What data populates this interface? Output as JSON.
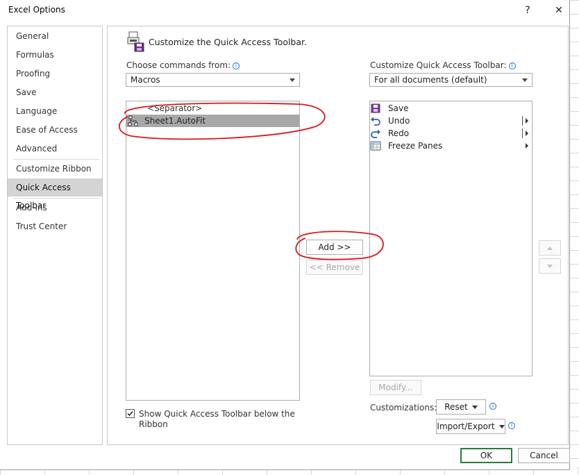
{
  "window": {
    "title": "Excel Options",
    "help_label": "?",
    "close_label": "✕"
  },
  "nav": {
    "items": [
      {
        "label": "General"
      },
      {
        "label": "Formulas"
      },
      {
        "label": "Proofing"
      },
      {
        "label": "Save"
      },
      {
        "label": "Language"
      },
      {
        "label": "Ease of Access"
      },
      {
        "label": "Advanced"
      },
      {
        "label": "Customize Ribbon"
      },
      {
        "label": "Quick Access Toolbar",
        "selected": true
      },
      {
        "label": "Add-ins"
      },
      {
        "label": "Trust Center"
      }
    ]
  },
  "main": {
    "heading": "Customize the Quick Access Toolbar.",
    "choose_label": "Choose commands from:",
    "choose_value": "Macros",
    "customize_label": "Customize Quick Access Toolbar:",
    "customize_value": "For all documents (default)",
    "left_list": [
      {
        "label": "<Separator>"
      },
      {
        "label": "Sheet1.AutoFit",
        "selected": true
      }
    ],
    "right_list": [
      {
        "label": "Save",
        "icon": "save-icon"
      },
      {
        "label": "Undo",
        "icon": "undo-icon",
        "submenu": true
      },
      {
        "label": "Redo",
        "icon": "redo-icon",
        "submenu": true
      },
      {
        "label": "Freeze Panes",
        "icon": "freeze-panes-icon",
        "submenu": true
      }
    ],
    "add_label": "Add >>",
    "remove_label": "<< Remove",
    "modify_label": "Modify...",
    "customizations_label": "Customizations:",
    "reset_label": "Reset",
    "import_export_label": "Import/Export",
    "show_below_label_line1": "Show Quick Access Toolbar below the",
    "show_below_label_line2": "Ribbon",
    "show_below_checked": true
  },
  "footer": {
    "ok_label": "OK",
    "cancel_label": "Cancel"
  },
  "colors": {
    "annotation_red": "#e0141c",
    "selected_nav": "#d4d4d4",
    "ok_border": "#2a7a3a"
  }
}
